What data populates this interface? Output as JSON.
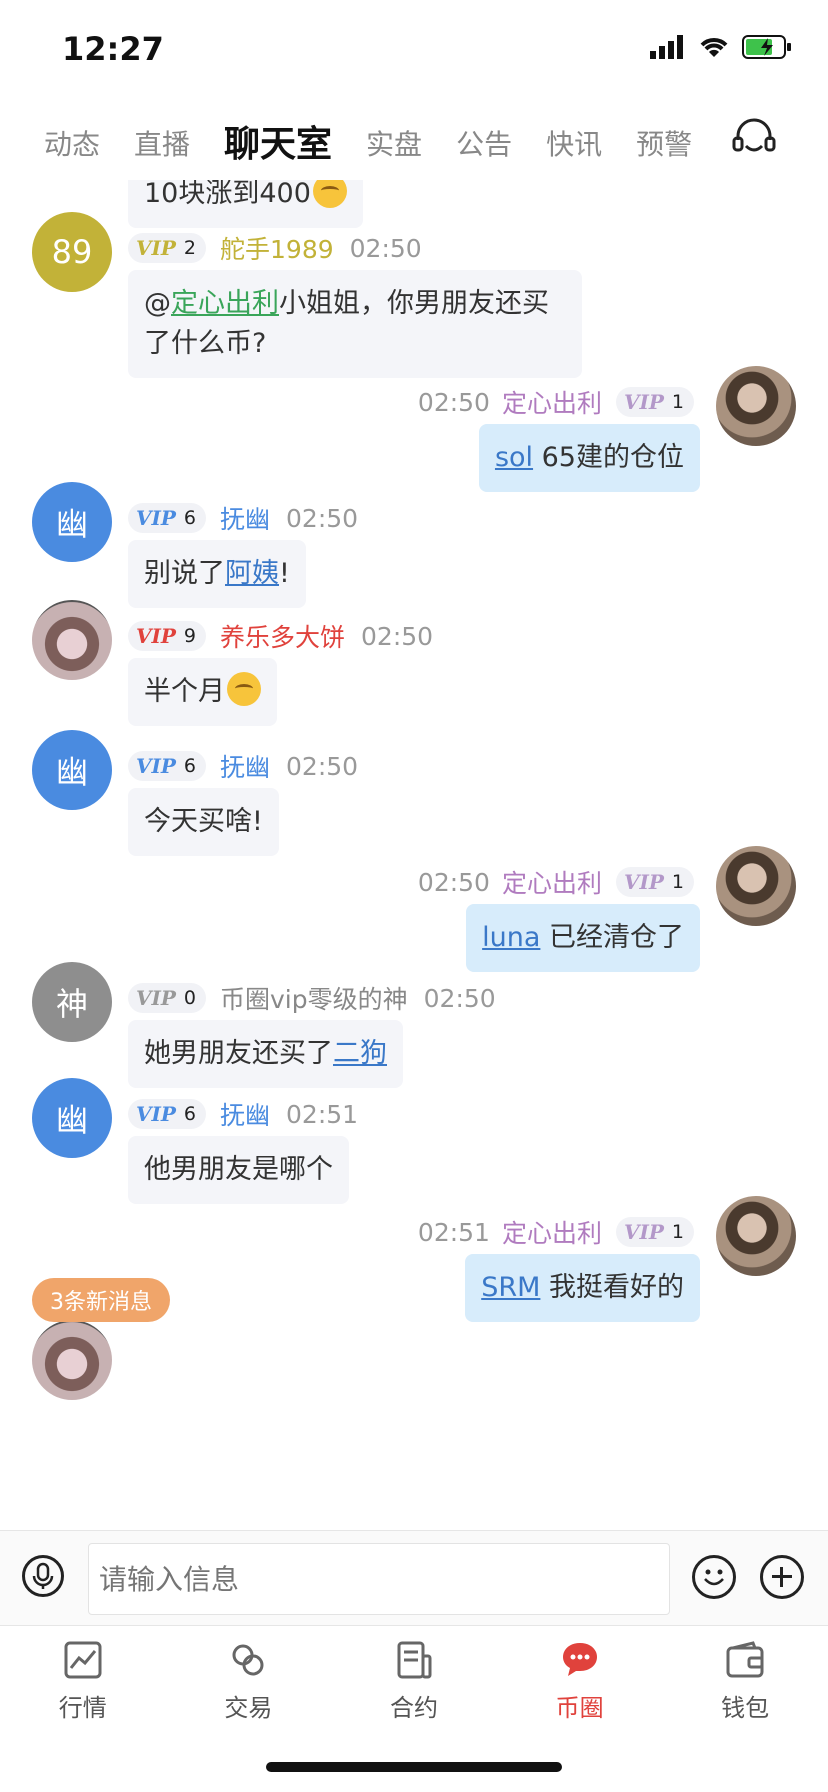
{
  "status": {
    "time": "12:27"
  },
  "tabs": [
    {
      "label": "动态"
    },
    {
      "label": "直播"
    },
    {
      "label": "聊天室"
    },
    {
      "label": "实盘"
    },
    {
      "label": "公告"
    },
    {
      "label": "快讯"
    },
    {
      "label": "预警"
    }
  ],
  "messages": {
    "m0": {
      "text": "10块涨到400"
    },
    "m1": {
      "avatar_text": "89",
      "vip": "2",
      "name": "舵手1989",
      "time": "02:50",
      "mention": "定心出利",
      "text": "小姐姐，你男朋友还买了什么币?",
      "name_color": "#c2b238"
    },
    "m2": {
      "time": "02:50",
      "name": "定心出利",
      "vip": "1",
      "link": "sol",
      "text": " 65建的仓位"
    },
    "m3": {
      "avatar_text": "幽",
      "vip": "6",
      "name": "抚幽",
      "time": "02:50",
      "text": "别说了",
      "link": "阿姨",
      "text_after": "!"
    },
    "m4": {
      "vip": "9",
      "name": "养乐多大饼",
      "time": "02:50",
      "text": "半个月"
    },
    "m5": {
      "avatar_text": "幽",
      "vip": "6",
      "name": "抚幽",
      "time": "02:50",
      "text": "今天买啥!"
    },
    "m6": {
      "time": "02:50",
      "name": "定心出利",
      "vip": "1",
      "link": "luna",
      "text": " 已经清仓了"
    },
    "m7": {
      "avatar_text": "神",
      "vip": "0",
      "name": "币圈vip零级的神",
      "time": "02:50",
      "text": "她男朋友还买了",
      "link": "二狗"
    },
    "m8": {
      "avatar_text": "幽",
      "vip": "6",
      "name": "抚幽",
      "time": "02:51",
      "text": "他男朋友是哪个"
    },
    "m9": {
      "time": "02:51",
      "name": "定心出利",
      "vip": "1",
      "link": "SRM",
      "text": " 我挺看好的"
    }
  },
  "vip_label": "VIP",
  "new_messages": "3条新消息",
  "input": {
    "placeholder": "请输入信息"
  },
  "nav": [
    {
      "label": "行情",
      "icon": "chart-icon"
    },
    {
      "label": "交易",
      "icon": "exchange-icon"
    },
    {
      "label": "合约",
      "icon": "contract-icon"
    },
    {
      "label": "币圈",
      "icon": "chat-bubble-icon"
    },
    {
      "label": "钱包",
      "icon": "wallet-icon"
    }
  ],
  "colors": {
    "accent": "#e0423c",
    "link": "#3a78c8",
    "bubble_self": "#d7ecfb",
    "bubble_other": "#f4f5f9",
    "blue_avatar": "#4a8be0",
    "gray_avatar": "#8e8e8e",
    "olive_avatar": "#c2b238"
  }
}
